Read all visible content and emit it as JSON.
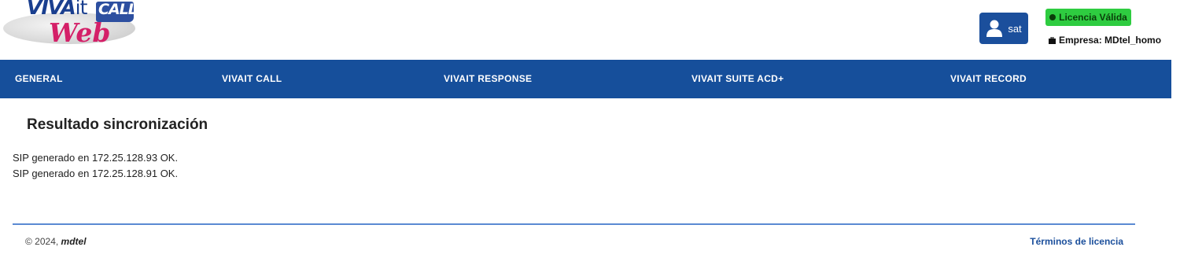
{
  "logo": {
    "viva": "VIVA",
    "it": "it",
    "call": "CALL",
    "web": "Web"
  },
  "user": {
    "name": "sat",
    "icon": "user-icon"
  },
  "license": {
    "label": "Licencia Válida",
    "color": "#2ecc40"
  },
  "company": {
    "label": "Empresa: MDtel_homo"
  },
  "nav": {
    "background": "#164f9b",
    "items": [
      {
        "label": "GENERAL"
      },
      {
        "label": "VIVAIT CALL"
      },
      {
        "label": "VIVAIT RESPONSE"
      },
      {
        "label": "VIVAIT SUITE ACD+"
      },
      {
        "label": "VIVAIT RECORD"
      }
    ]
  },
  "main": {
    "title": "Resultado sincronización",
    "results": [
      "SIP generado en 172.25.128.93 OK.",
      "SIP generado en 172.25.128.91 OK."
    ]
  },
  "footer": {
    "copyright_prefix": "© 2024, ",
    "copyright_brand": "mdtel",
    "terms_label": "Términos de licencia"
  }
}
